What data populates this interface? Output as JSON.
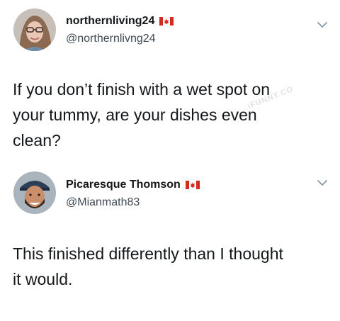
{
  "tweets": [
    {
      "display_name": "northernliving24",
      "handle": "@northernlivng24",
      "flag": "canada-flag-icon",
      "text": "If you don’t finish with a wet spot on your tummy, are your dishes even clean?",
      "text_lines": [
        "If you don’t finish with a wet spot on",
        "your tummy, are your dishes even",
        "clean?"
      ]
    },
    {
      "display_name": "Picaresque Thomson",
      "handle": "@Mianmath83",
      "flag": "canada-flag-icon",
      "text": "This finished differently than I thought it would.",
      "text_lines": [
        "This finished differently than I thought",
        "it would."
      ]
    }
  ],
  "watermark": "iFUNNY.CO",
  "colors": {
    "text": "#14171a",
    "handle": "#3f4a54",
    "flag_red": "#d52b1e",
    "chevron": "#8899a6"
  }
}
